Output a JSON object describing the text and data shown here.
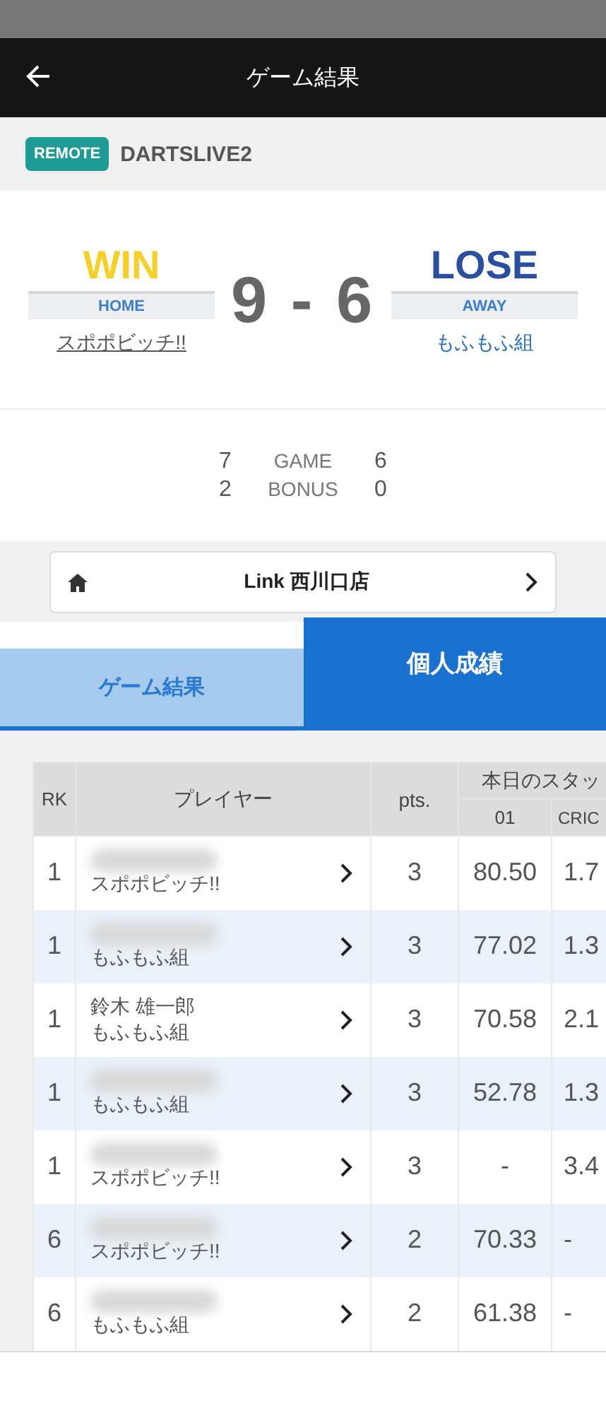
{
  "header": {
    "title": "ゲーム結果"
  },
  "match": {
    "badge": "REMOTE",
    "machine": "DARTSLIVE2"
  },
  "teams": [
    {
      "result": "WIN",
      "side": "HOME",
      "name": "スポポビッチ!!",
      "winner": true
    },
    {
      "result": "LOSE",
      "side": "AWAY",
      "name": "もふもふ組",
      "winner": false
    }
  ],
  "score": {
    "home": "9",
    "separator": "-",
    "away": "6"
  },
  "breakdown": [
    {
      "home": "7",
      "label": "GAME",
      "away": "6"
    },
    {
      "home": "2",
      "label": "BONUS",
      "away": "0"
    }
  ],
  "shop": {
    "name": "Link 西川口店"
  },
  "tabs": [
    {
      "label": "ゲーム結果",
      "selected": false
    },
    {
      "label": "個人成績",
      "selected": true
    }
  ],
  "table": {
    "columns": {
      "rank": "RK",
      "player": "プレイヤー",
      "points": "pts.",
      "stats_group": "本日のスタッ",
      "stat_1": "01",
      "stat_2": "CRIC"
    },
    "rows": [
      {
        "rank": "1",
        "blurred": true,
        "team": "スポポビッチ!!",
        "points": "3",
        "stat_1": "80.50",
        "stat_2": "1.7"
      },
      {
        "rank": "1",
        "blurred": true,
        "team": "もふもふ組",
        "points": "3",
        "stat_1": "77.02",
        "stat_2": "1.3"
      },
      {
        "rank": "1",
        "blurred": false,
        "player": "鈴木 雄一郎",
        "team": "もふもふ組",
        "points": "3",
        "stat_1": "70.58",
        "stat_2": "2.1"
      },
      {
        "rank": "1",
        "blurred": true,
        "team": "もふもふ組",
        "points": "3",
        "stat_1": "52.78",
        "stat_2": "1.3"
      },
      {
        "rank": "1",
        "blurred": true,
        "team": "スポポビッチ!!",
        "points": "3",
        "stat_1": "-",
        "stat_2": "3.4"
      },
      {
        "rank": "6",
        "blurred": true,
        "team": "スポポビッチ!!",
        "points": "2",
        "stat_1": "70.33",
        "stat_2": "-"
      },
      {
        "rank": "6",
        "blurred": true,
        "team": "もふもふ組",
        "points": "2",
        "stat_1": "61.38",
        "stat_2": "-"
      }
    ]
  }
}
